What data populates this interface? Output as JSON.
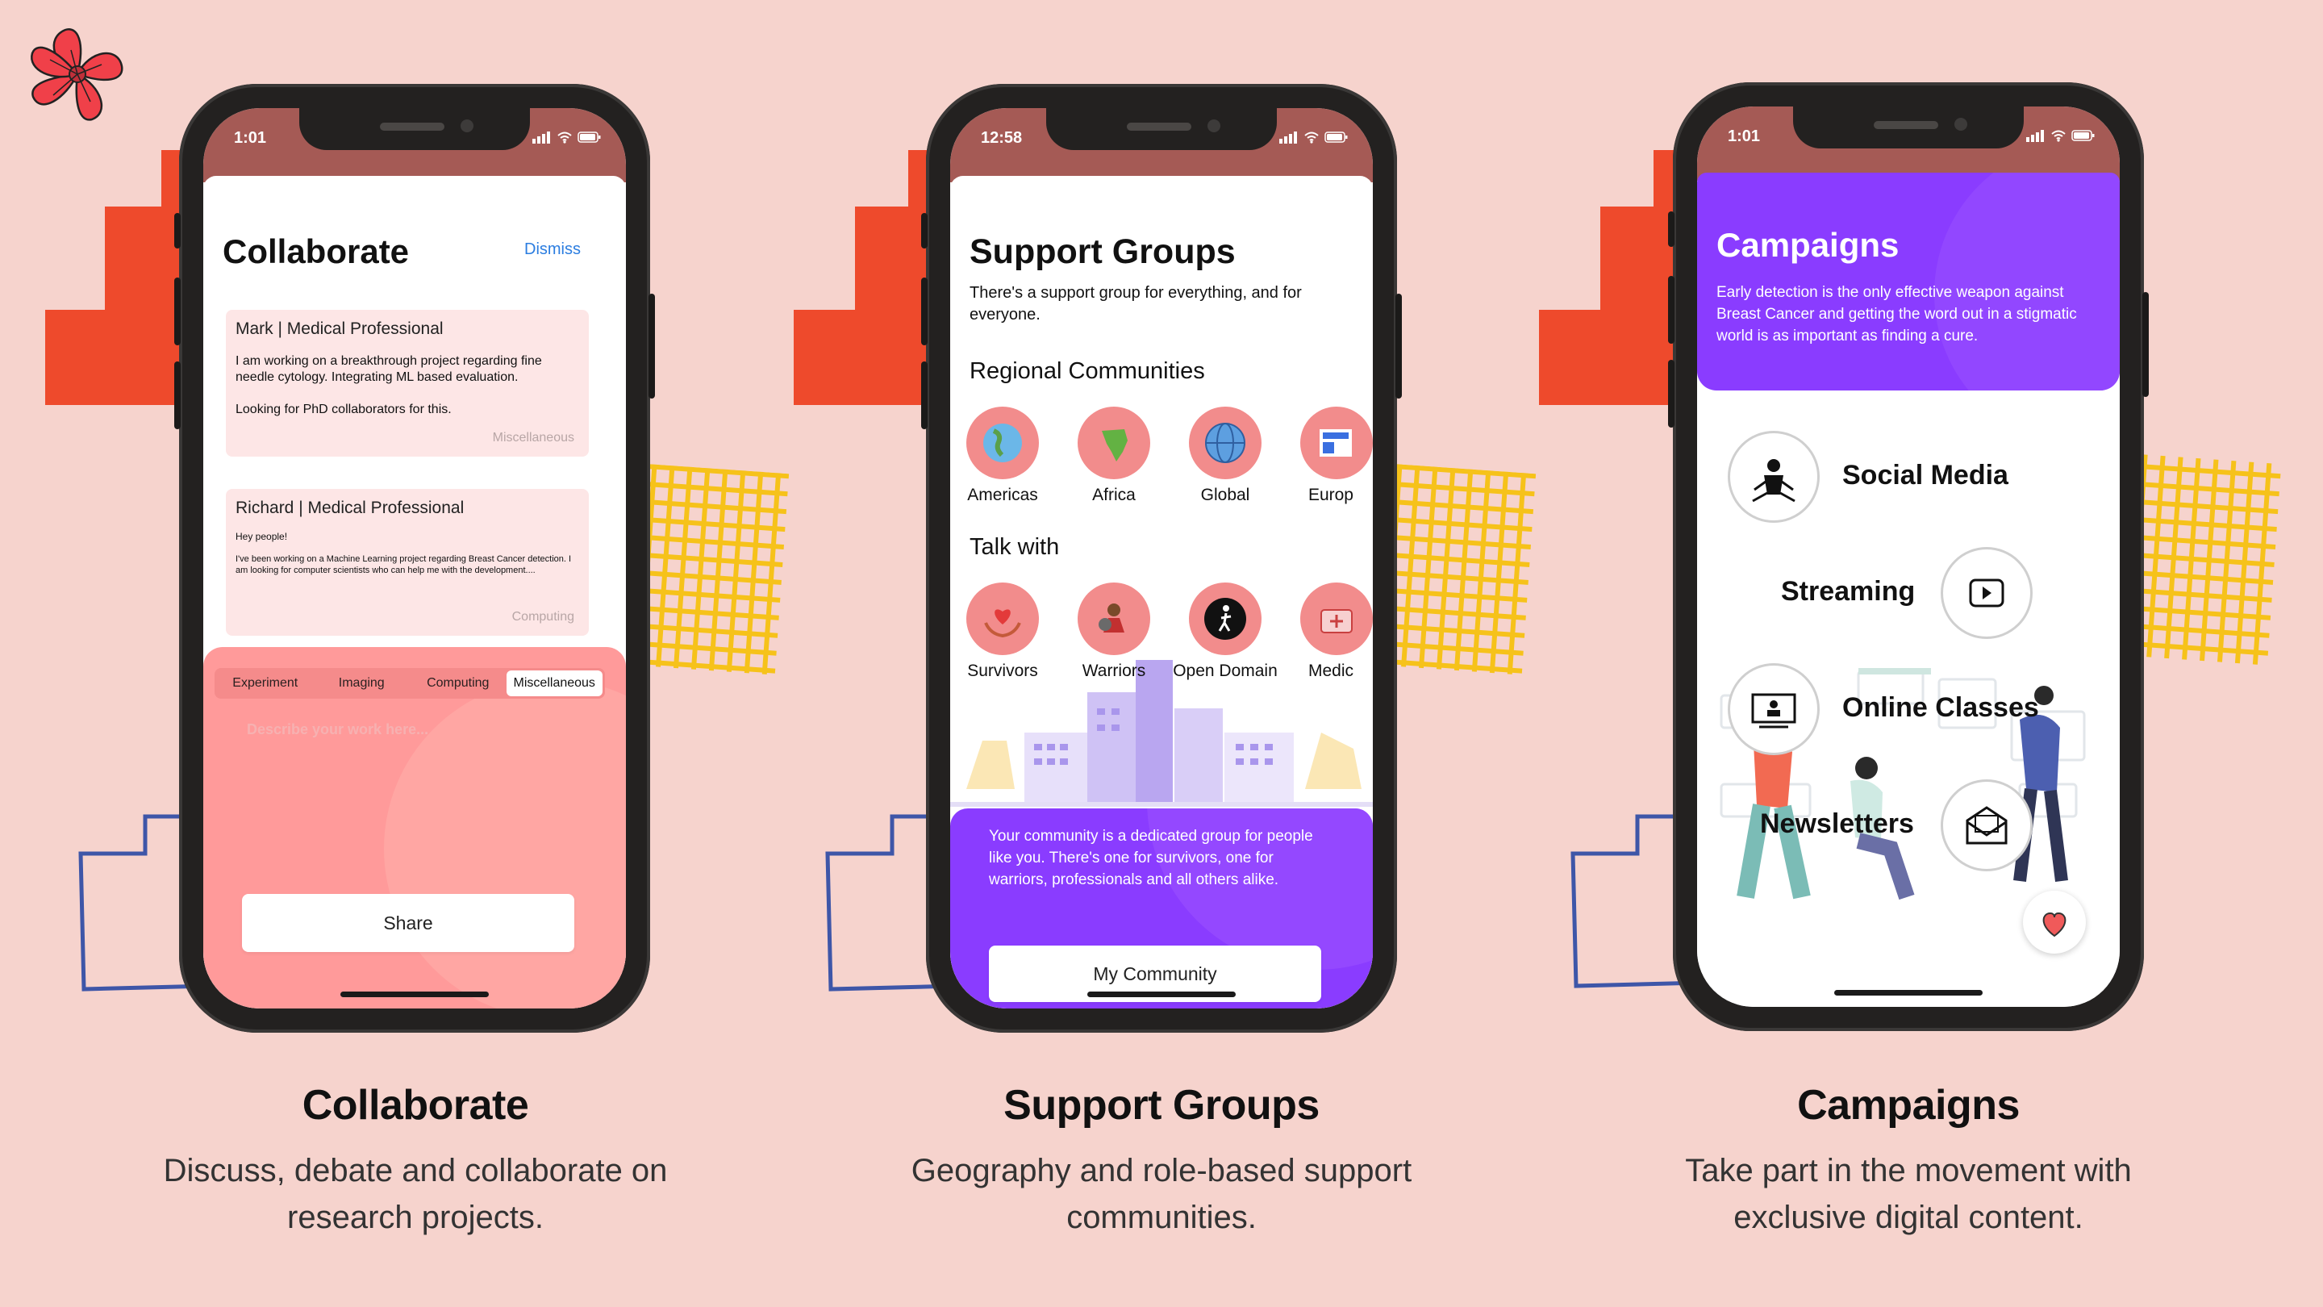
{
  "phones": [
    {
      "time": "1:01",
      "title": "Collaborate",
      "dismiss": "Dismiss",
      "cards": [
        {
          "author": "Mark | Medical Professional",
          "body": "I am working on a breakthrough project regarding fine needle cytology. Integrating ML based evaluation.",
          "body2": "Looking for PhD collaborators for this.",
          "tag": "Miscellaneous"
        },
        {
          "author": "Richard | Medical Professional",
          "body": "Hey people!",
          "body2": "I've been working on a Machine Learning project regarding Breast Cancer detection. I am looking for computer scientists who can help me with the development....",
          "tag": "Computing"
        }
      ],
      "segments": [
        "Experiment",
        "Imaging",
        "Computing",
        "Miscellaneous"
      ],
      "selected_segment": "Miscellaneous",
      "placeholder": "Describe your work here...",
      "button": "Share"
    },
    {
      "time": "12:58",
      "title": "Support Groups",
      "subtitle": "There's a support group for everything, and for everyone.",
      "regional_heading": "Regional Communities",
      "regional": [
        {
          "label": "Americas",
          "icon": "globe-americas-icon"
        },
        {
          "label": "Africa",
          "icon": "africa-map-icon"
        },
        {
          "label": "Global",
          "icon": "globe-icon"
        },
        {
          "label": "Europ",
          "icon": "newspaper-icon"
        }
      ],
      "talk_heading": "Talk with",
      "talk": [
        {
          "label": "Survivors",
          "icon": "heart-hands-icon"
        },
        {
          "label": "Warriors",
          "icon": "warrior-icon"
        },
        {
          "label": "Open Domain",
          "icon": "walking-person-icon"
        },
        {
          "label": "Medic",
          "icon": "medical-kit-icon"
        }
      ],
      "panel_text": "Your community is a dedicated group for people like you. There's one for survivors, one for warriors, professionals and all others alike.",
      "button": "My Community"
    },
    {
      "time": "1:01",
      "title": "Campaigns",
      "subtitle": "Early detection is the only effective weapon against Breast Cancer and getting the word out in a stigmatic world is as important as finding a cure.",
      "items": [
        {
          "label": "Social Media",
          "icon": "social-media-icon"
        },
        {
          "label": "Streaming",
          "icon": "play-icon"
        },
        {
          "label": "Online Classes",
          "icon": "online-class-icon"
        },
        {
          "label": "Newsletters",
          "icon": "newsletter-icon"
        }
      ],
      "fab_icon": "heart-icon"
    }
  ],
  "captions": [
    {
      "title": "Collaborate",
      "desc": "Discuss, debate and collaborate on research projects."
    },
    {
      "title": "Support Groups",
      "desc": "Geography and role-based support communities."
    },
    {
      "title": "Campaigns",
      "desc": "Take part in the movement with exclusive digital content."
    }
  ],
  "colors": {
    "background": "#f6d3cd",
    "coral": "#ff9a9a",
    "purple": "#8a3cff",
    "statusbar": "#a55a55",
    "accent_orange": "#ee4a2c",
    "accent_yellow": "#f6c21a",
    "accent_blue": "#3e56a8",
    "logo_red": "#f04049"
  },
  "logo_icon": "flower-logo-icon"
}
